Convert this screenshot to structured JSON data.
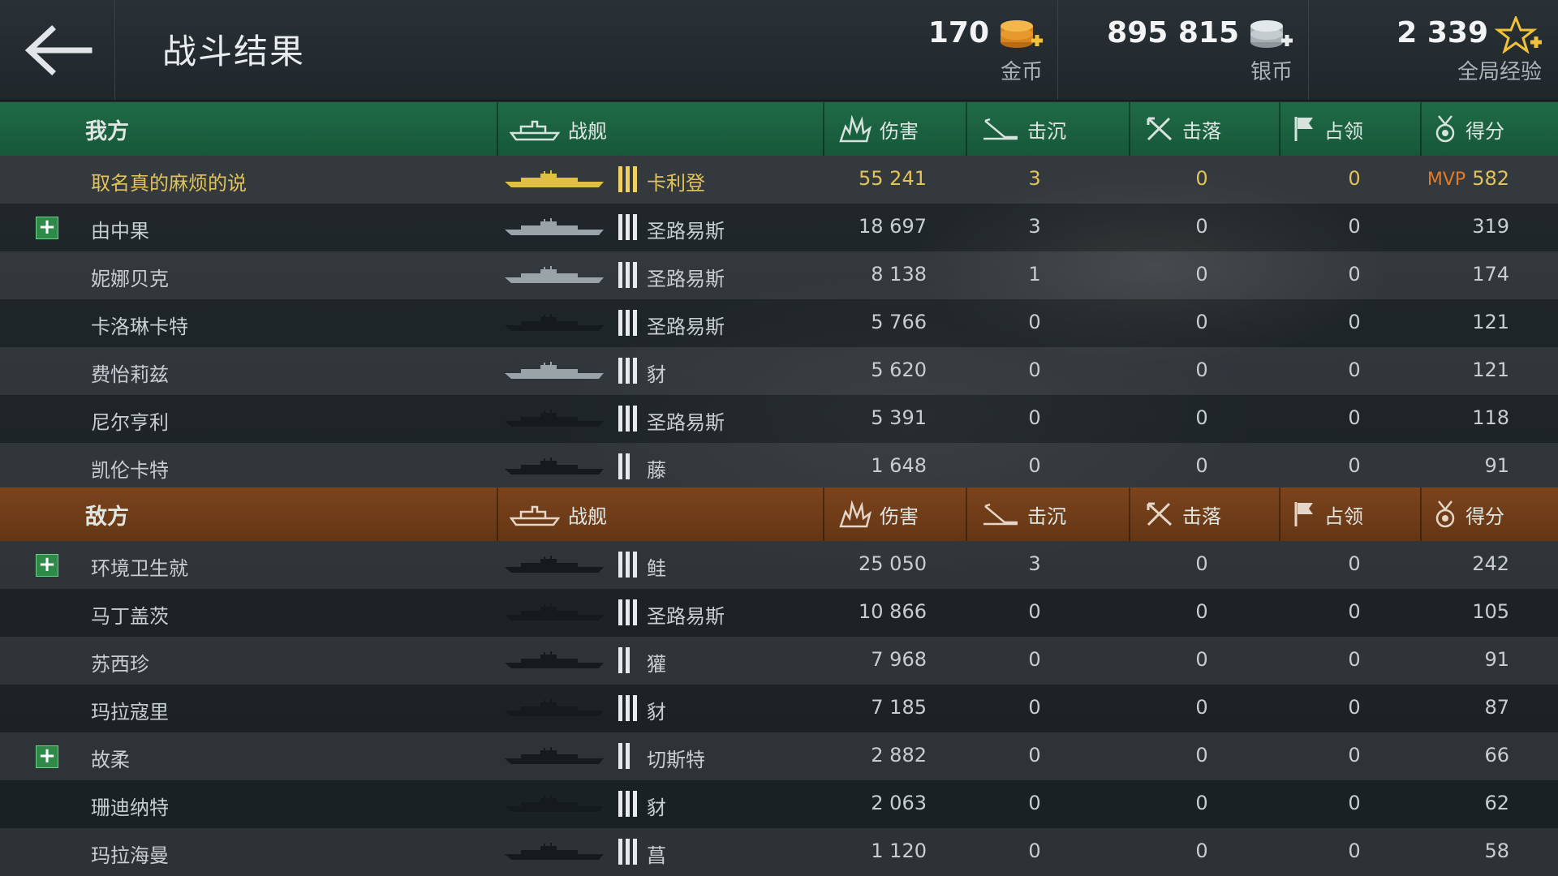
{
  "header": {
    "title": "战斗结果",
    "back_icon": "arrow-left-icon",
    "currencies": [
      {
        "amount": "170",
        "label": "金币",
        "icon": "gold-coins-plus-icon",
        "color": "#e0902a"
      },
      {
        "amount": "895 815",
        "label": "银币",
        "icon": "silver-coins-plus-icon",
        "color": "#d7dde0"
      },
      {
        "amount": "2 339",
        "label": "全局经验",
        "icon": "star-plus-icon",
        "color": "#f0c23a"
      }
    ]
  },
  "columns": {
    "ship": "战舰",
    "damage": "伤害",
    "sunk": "击沉",
    "downed": "击落",
    "capture": "占领",
    "score": "得分"
  },
  "colors": {
    "ally_header": "#1f6b47",
    "enemy_header": "#7a441d",
    "highlight_text": "#e2c35a",
    "mvp": "#e27a2a"
  },
  "ally": {
    "team_label": "我方",
    "players": [
      {
        "name": "取名真的麻烦的说",
        "ship": "卡利登",
        "tier": 3,
        "damage": "55 241",
        "sunk": "3",
        "downed": "0",
        "capture": "0",
        "score": "582",
        "mvp": "MVP",
        "highlight": true,
        "plus": false,
        "ship_color": "#e0c040"
      },
      {
        "name": "由中果",
        "ship": "圣路易斯",
        "tier": 3,
        "damage": "18 697",
        "sunk": "3",
        "downed": "0",
        "capture": "0",
        "score": "319",
        "highlight": false,
        "plus": true,
        "ship_color": "#9aa3a8"
      },
      {
        "name": "妮娜贝克",
        "ship": "圣路易斯",
        "tier": 3,
        "damage": "8 138",
        "sunk": "1",
        "downed": "0",
        "capture": "0",
        "score": "174",
        "highlight": false,
        "plus": false,
        "ship_color": "#9aa3a8"
      },
      {
        "name": "卡洛琳卡特",
        "ship": "圣路易斯",
        "tier": 3,
        "damage": "5 766",
        "sunk": "0",
        "downed": "0",
        "capture": "0",
        "score": "121",
        "highlight": false,
        "plus": false,
        "ship_color": "#141a1d"
      },
      {
        "name": "费怡莉兹",
        "ship": "豺",
        "tier": 3,
        "damage": "5 620",
        "sunk": "0",
        "downed": "0",
        "capture": "0",
        "score": "121",
        "highlight": false,
        "plus": false,
        "ship_color": "#9aa3a8"
      },
      {
        "name": "尼尔亨利",
        "ship": "圣路易斯",
        "tier": 3,
        "damage": "5 391",
        "sunk": "0",
        "downed": "0",
        "capture": "0",
        "score": "118",
        "highlight": false,
        "plus": false,
        "ship_color": "#141a1d"
      },
      {
        "name": "凯伦卡特",
        "ship": "藤",
        "tier": 2,
        "damage": "1 648",
        "sunk": "0",
        "downed": "0",
        "capture": "0",
        "score": "91",
        "highlight": false,
        "plus": false,
        "ship_color": "#141a1d"
      }
    ]
  },
  "enemy": {
    "team_label": "敌方",
    "players": [
      {
        "name": "环境卫生就",
        "ship": "鲑",
        "tier": 3,
        "damage": "25 050",
        "sunk": "3",
        "downed": "0",
        "capture": "0",
        "score": "242",
        "highlight": false,
        "plus": true,
        "ship_color": "#141a1d"
      },
      {
        "name": "马丁盖茨",
        "ship": "圣路易斯",
        "tier": 3,
        "damage": "10 866",
        "sunk": "0",
        "downed": "0",
        "capture": "0",
        "score": "105",
        "highlight": false,
        "plus": false,
        "ship_color": "#141a1d"
      },
      {
        "name": "苏西珍",
        "ship": "獾",
        "tier": 2,
        "damage": "7 968",
        "sunk": "0",
        "downed": "0",
        "capture": "0",
        "score": "91",
        "highlight": false,
        "plus": false,
        "ship_color": "#141a1d"
      },
      {
        "name": "玛拉寇里",
        "ship": "豺",
        "tier": 3,
        "damage": "7 185",
        "sunk": "0",
        "downed": "0",
        "capture": "0",
        "score": "87",
        "highlight": false,
        "plus": false,
        "ship_color": "#141a1d"
      },
      {
        "name": "故柔",
        "ship": "切斯特",
        "tier": 2,
        "damage": "2 882",
        "sunk": "0",
        "downed": "0",
        "capture": "0",
        "score": "66",
        "highlight": false,
        "plus": true,
        "ship_color": "#141a1d"
      },
      {
        "name": "珊迪纳特",
        "ship": "豺",
        "tier": 3,
        "damage": "2 063",
        "sunk": "0",
        "downed": "0",
        "capture": "0",
        "score": "62",
        "highlight": false,
        "plus": false,
        "ship_color": "#141a1d"
      },
      {
        "name": "玛拉海曼",
        "ship": "菖",
        "tier": 3,
        "damage": "1 120",
        "sunk": "0",
        "downed": "0",
        "capture": "0",
        "score": "58",
        "highlight": false,
        "plus": false,
        "ship_color": "#141a1d"
      }
    ]
  }
}
